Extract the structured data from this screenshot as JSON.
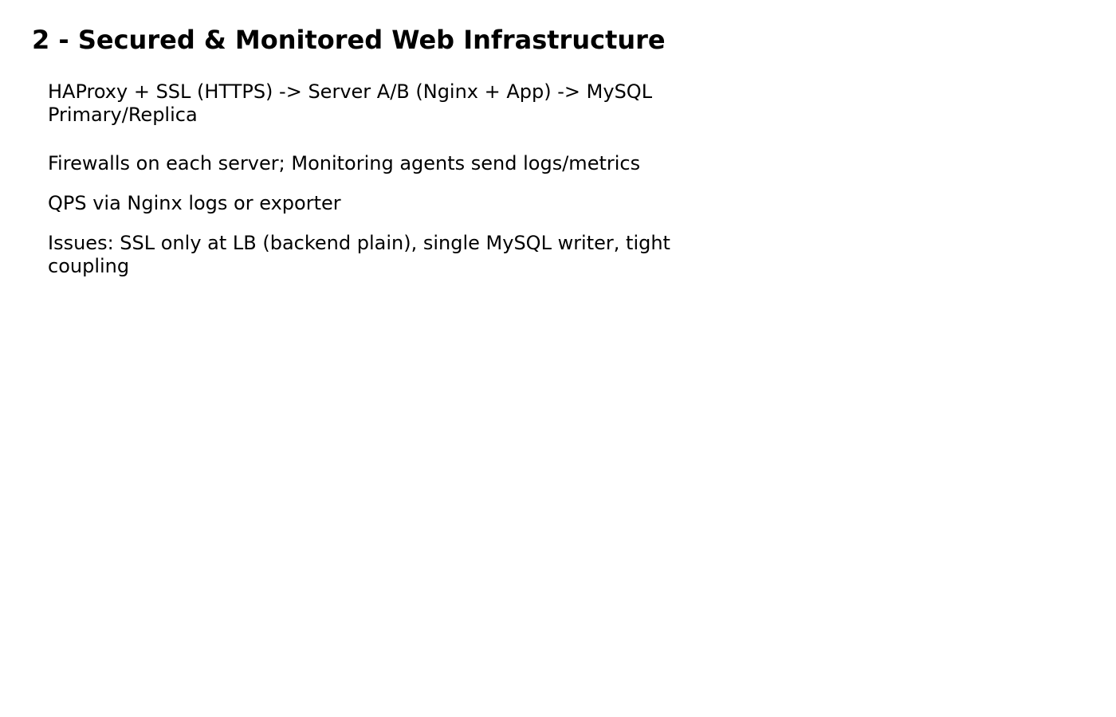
{
  "page": {
    "title": "2 - Secured & Monitored Web Infrastructure",
    "lines": [
      "HAProxy + SSL (HTTPS) -> Server A/B (Nginx + App) -> MySQL Primary/Replica",
      "Firewalls on each server; Monitoring agents send logs/metrics",
      "QPS via Nginx logs or exporter",
      "Issues: SSL only at LB (backend plain), single MySQL writer, tight coupling"
    ]
  }
}
